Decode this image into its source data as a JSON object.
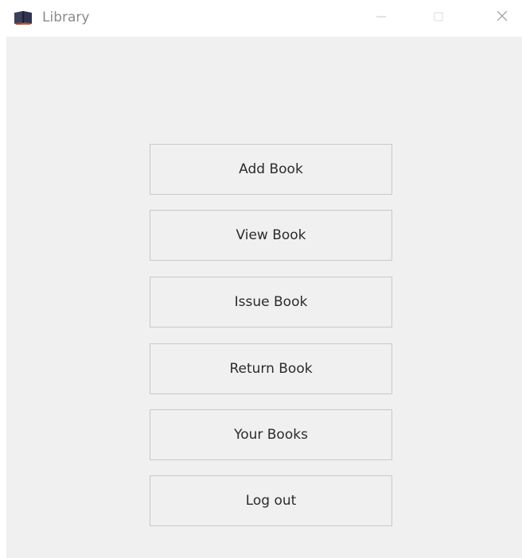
{
  "window": {
    "title": "Library",
    "app_icon": "book-icon",
    "controls": {
      "minimize_icon": "minimize-icon",
      "maximize_icon": "maximize-icon",
      "close_icon": "close-icon"
    }
  },
  "menu": {
    "add_book": "Add Book",
    "view_book": "View Book",
    "issue_book": "Issue Book",
    "return_book": "Return Book",
    "your_books": "Your Books",
    "log_out": "Log out"
  },
  "colors": {
    "client_background": "#f0f0f0",
    "button_border": "#c8c8c8",
    "title_text": "#8a8a8a"
  }
}
